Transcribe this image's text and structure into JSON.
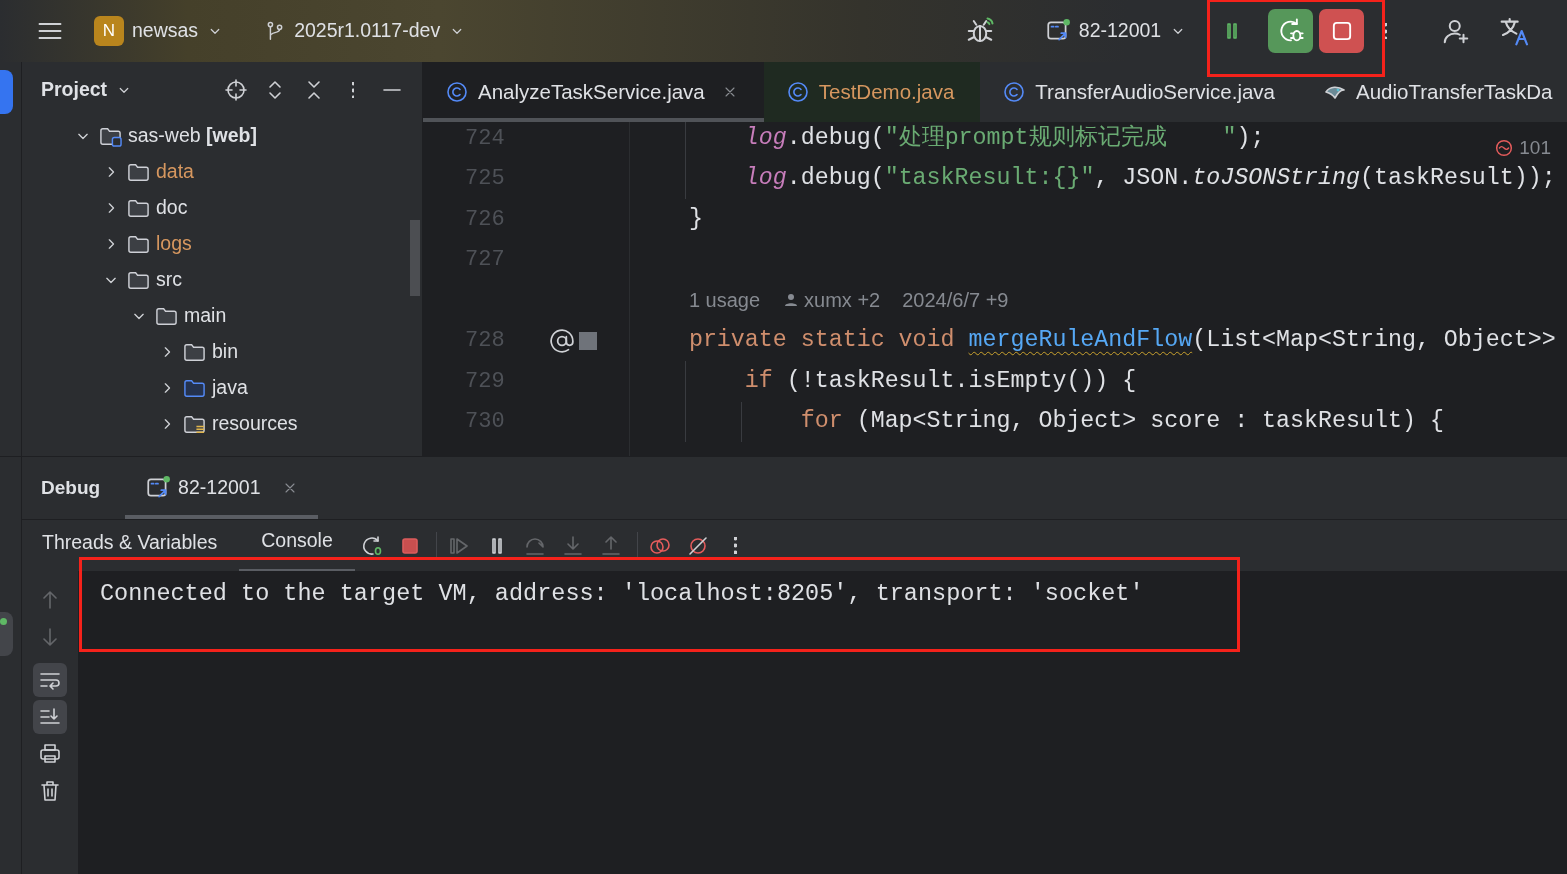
{
  "top_bar": {
    "project": {
      "badge": "N",
      "name": "newsas"
    },
    "branch": "2025r1.0117-dev",
    "run_config": "82-12001",
    "run_controls": {
      "highlighted": true
    }
  },
  "project_panel": {
    "title": "Project",
    "tree": [
      {
        "label": "sas-web **[web]**",
        "kind": "module",
        "expanded": true,
        "color": "#dfe1e5",
        "children": [
          {
            "label": "data",
            "kind": "folder",
            "expanded": false,
            "color": "#d6975f"
          },
          {
            "label": "doc",
            "kind": "folder",
            "expanded": false,
            "color": "#dfe1e5"
          },
          {
            "label": "logs",
            "kind": "folder",
            "expanded": false,
            "color": "#d6975f"
          },
          {
            "label": "src",
            "kind": "folder",
            "expanded": true,
            "color": "#dfe1e5",
            "children": [
              {
                "label": "main",
                "kind": "folder",
                "expanded": true,
                "color": "#dfe1e5",
                "children": [
                  {
                    "label": "bin",
                    "kind": "folder",
                    "expanded": false,
                    "color": "#dfe1e5"
                  },
                  {
                    "label": "java",
                    "kind": "source",
                    "expanded": false,
                    "color": "#dfe1e5"
                  },
                  {
                    "label": "resources",
                    "kind": "resources",
                    "expanded": false,
                    "color": "#dfe1e5"
                  }
                ]
              }
            ]
          }
        ]
      }
    ]
  },
  "editor": {
    "tabs": [
      {
        "label": "AnalyzeTaskService.java",
        "kind": "class",
        "selected": true,
        "color": "#dfe1e5"
      },
      {
        "label": "TestDemo.java",
        "kind": "test",
        "selected": false,
        "color": "#d6975f"
      },
      {
        "label": "TransferAudioService.java",
        "kind": "class",
        "selected": false,
        "color": "#dfe1e5"
      },
      {
        "label": "AudioTransferTaskDa",
        "kind": "other",
        "selected": false,
        "color": "#dfe1e5"
      }
    ],
    "problems": "101",
    "lines": [
      {
        "kind": "code",
        "number": "724",
        "tokens": [
          {
            "kind": "field",
            "text": "        log"
          },
          {
            "kind": "plain",
            "text": ".debug("
          },
          {
            "kind": "string",
            "text": "\"处理prompt规则标记完成    \""
          },
          {
            "kind": "plain",
            "text": ");"
          }
        ]
      },
      {
        "kind": "code",
        "number": "725",
        "tokens": [
          {
            "kind": "field",
            "text": "        log"
          },
          {
            "kind": "plain",
            "text": ".debug("
          },
          {
            "kind": "string",
            "text": "\"taskResult:{}\""
          },
          {
            "kind": "plain",
            "text": ", JSON."
          },
          {
            "kind": "static",
            "text": "toJSONString"
          },
          {
            "kind": "plain",
            "text": "(taskResult));"
          }
        ]
      },
      {
        "kind": "code",
        "number": "726",
        "tokens": [
          {
            "kind": "plain",
            "text": "    }"
          }
        ]
      },
      {
        "kind": "code",
        "number": "727"
      },
      {
        "kind": "hint",
        "tokens": [
          {
            "kind": "usage",
            "text": "    1 usage"
          },
          {
            "kind": "author",
            "text": "xumx +2"
          },
          {
            "kind": "date",
            "text": "2024/6/7 +9"
          }
        ]
      },
      {
        "kind": "code",
        "number": "728",
        "annotated": true,
        "tokens": [
          {
            "kind": "keyword",
            "text": "    private static void "
          },
          {
            "kind": "declaration",
            "text": "mergeRuleAndFlow"
          },
          {
            "kind": "plain",
            "text": "(List<Map<String, Object>>"
          }
        ]
      },
      {
        "kind": "code",
        "number": "729",
        "tokens": [
          {
            "kind": "keyword",
            "text": "        if"
          },
          {
            "kind": "plain",
            "text": " (!taskResult.isEmpty()) {"
          }
        ]
      },
      {
        "kind": "code",
        "number": "730",
        "tokens": [
          {
            "kind": "keyword",
            "text": "            for"
          },
          {
            "kind": "plain",
            "text": " (Map<String, Object> score : taskResult) {"
          }
        ]
      }
    ]
  },
  "debug": {
    "title": "Debug",
    "session_tab": {
      "label": "82-12001",
      "selected": true
    },
    "tabs": [
      {
        "label": "Threads & Variables",
        "selected": false
      },
      {
        "label": "Console",
        "selected": true
      }
    ],
    "toolbar": [
      {
        "kind": "rerun",
        "disabled": false
      },
      {
        "kind": "stop",
        "disabled": false
      },
      {
        "kind": "separator"
      },
      {
        "kind": "resume",
        "disabled": true
      },
      {
        "kind": "pause",
        "disabled": false
      },
      {
        "kind": "step-over",
        "disabled": true
      },
      {
        "kind": "step-into",
        "disabled": true
      },
      {
        "kind": "step-out",
        "disabled": true
      },
      {
        "kind": "separator"
      },
      {
        "kind": "breakpoints",
        "disabled": false
      },
      {
        "kind": "mute",
        "disabled": false
      },
      {
        "kind": "more",
        "disabled": false
      }
    ],
    "side_tools": [
      {
        "kind": "up",
        "active": false,
        "disabled": true
      },
      {
        "kind": "down",
        "active": false,
        "disabled": true
      },
      {
        "kind": "wrap",
        "active": true,
        "disabled": false
      },
      {
        "kind": "scroll-end",
        "active": true,
        "disabled": false
      },
      {
        "kind": "print",
        "active": false,
        "disabled": false
      },
      {
        "kind": "trash",
        "active": false,
        "disabled": false
      }
    ],
    "console": {
      "highlighted": true,
      "lines": [
        "Connected to the target VM, address: 'localhost:8205', transport: 'socket'"
      ]
    }
  }
}
